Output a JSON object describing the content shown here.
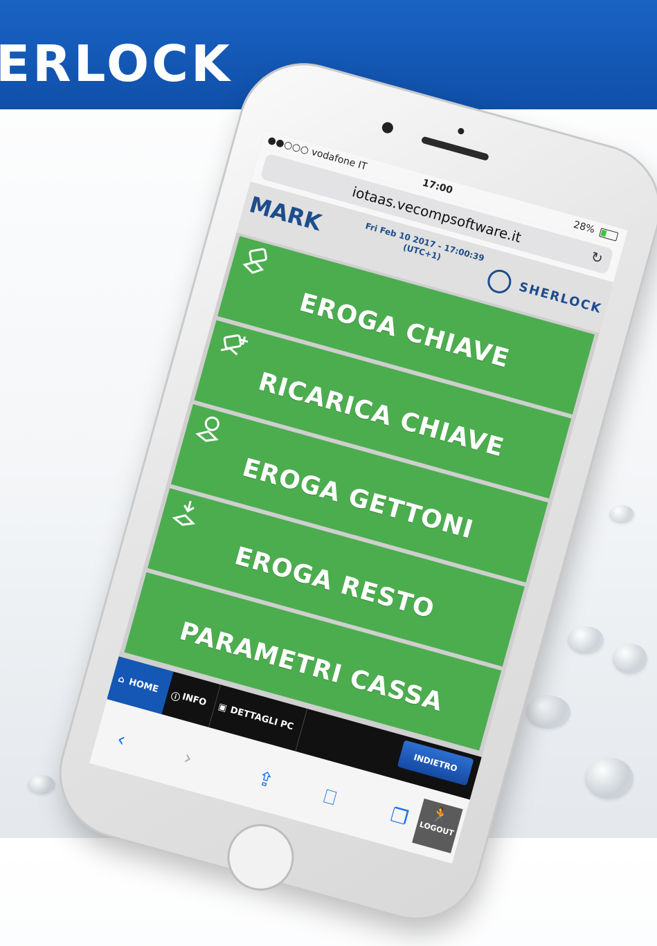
{
  "banner": {
    "title": "ERLOCK",
    "color": "#1457b5"
  },
  "status_bar": {
    "carrier": "●●○○○ vodafone IT",
    "time": "17:00",
    "battery": "28%"
  },
  "browser": {
    "url": "iotaas.vecompsoftware.it"
  },
  "header": {
    "logo_left": "MARK",
    "datetime": "Fri Feb 10 2017 - 17:00:39 (UTC+1)",
    "logo_right": "SHERLOCK"
  },
  "menu": [
    {
      "label": "EROGA CHIAVE",
      "icon": "key-dispense-icon"
    },
    {
      "label": "RICARICA CHIAVE",
      "icon": "key-recharge-icon"
    },
    {
      "label": "EROGA GETTONI",
      "icon": "token-dispense-icon"
    },
    {
      "label": "EROGA RESTO",
      "icon": "change-dispense-icon"
    },
    {
      "label": "PARAMETRI CASSA",
      "icon": ""
    }
  ],
  "tabbar": {
    "home": "HOME",
    "info": "INFO",
    "pc_details": "DETTAGLI PC",
    "back": "INDIETRO",
    "logout": "LOGOUT"
  },
  "colors": {
    "menu_green": "#4cad4f",
    "accent_blue": "#1457b5"
  }
}
